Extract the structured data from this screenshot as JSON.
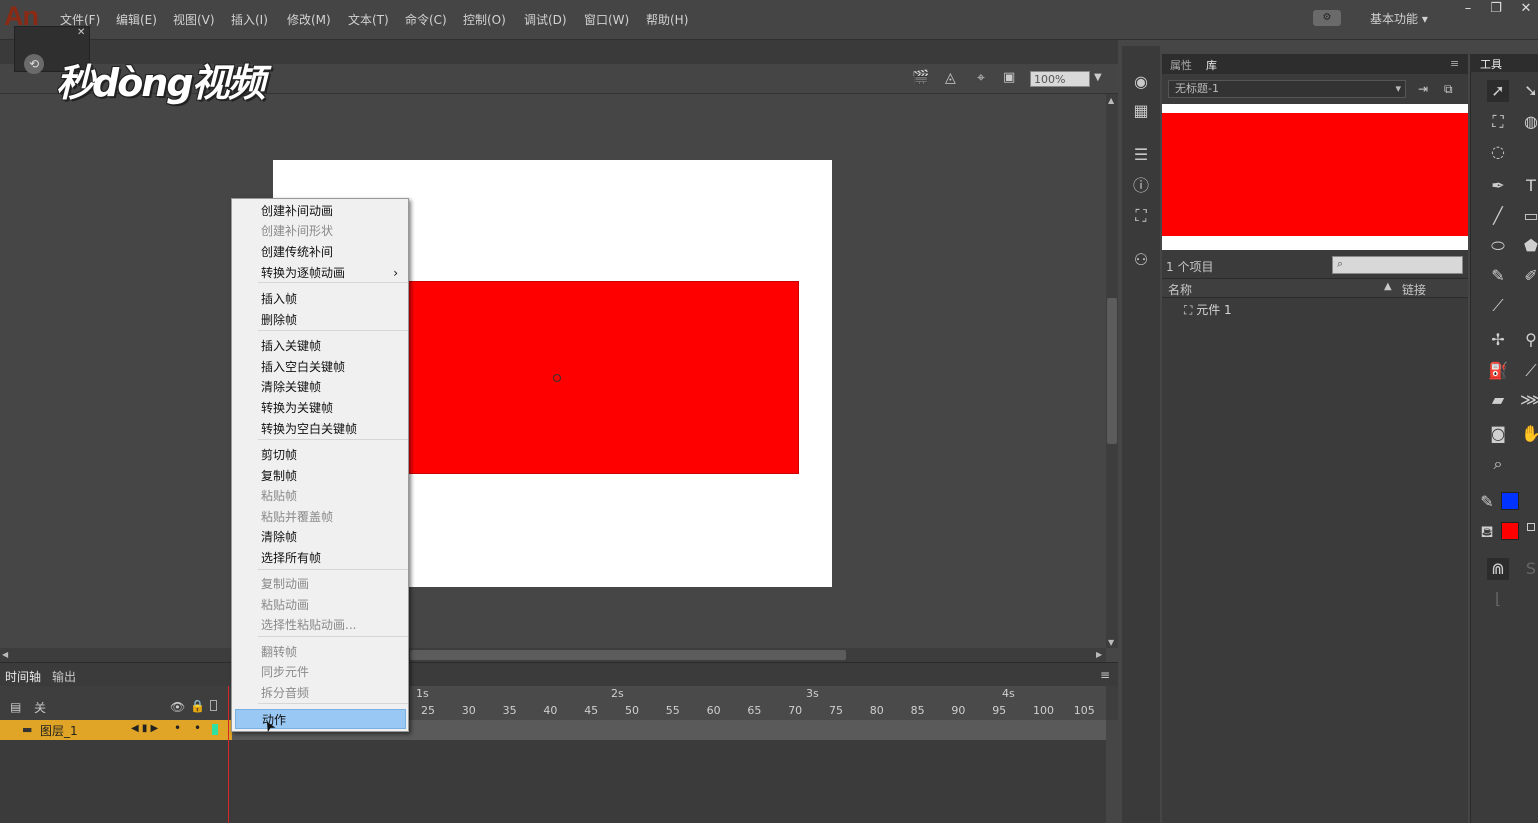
{
  "app": {
    "logo": "An"
  },
  "menubar": {
    "items": [
      "文件(F)",
      "编辑(E)",
      "视图(V)",
      "插入(I)",
      "修改(M)",
      "文本(T)",
      "命令(C)",
      "控制(O)",
      "调试(D)",
      "窗口(W)",
      "帮助(H)"
    ],
    "workspace": "基本功能"
  },
  "watermark": {
    "text": "秒dòng视频"
  },
  "editbar": {
    "zoom": "100%"
  },
  "timeline": {
    "tabs": [
      "时间轴",
      "输出"
    ],
    "layer_folder": "关",
    "layer_name": "图层_1",
    "seconds": [
      "1s",
      "2s",
      "3s",
      "4s"
    ],
    "frames": [
      "25",
      "30",
      "35",
      "40",
      "45",
      "50",
      "55",
      "60",
      "65",
      "70",
      "75",
      "80",
      "85",
      "90",
      "95",
      "100",
      "105"
    ]
  },
  "context_menu": {
    "items": [
      {
        "label": "创建补间动画",
        "enabled": true
      },
      {
        "label": "创建补间形状",
        "enabled": false
      },
      {
        "label": "创建传统补间",
        "enabled": true
      },
      {
        "label": "转换为逐帧动画",
        "enabled": true,
        "submenu": true
      },
      {
        "label": "插入帧",
        "enabled": true
      },
      {
        "label": "删除帧",
        "enabled": true
      },
      {
        "label": "插入关键帧",
        "enabled": true
      },
      {
        "label": "插入空白关键帧",
        "enabled": true
      },
      {
        "label": "清除关键帧",
        "enabled": true
      },
      {
        "label": "转换为关键帧",
        "enabled": true
      },
      {
        "label": "转换为空白关键帧",
        "enabled": true
      },
      {
        "label": "剪切帧",
        "enabled": true
      },
      {
        "label": "复制帧",
        "enabled": true
      },
      {
        "label": "粘贴帧",
        "enabled": false
      },
      {
        "label": "粘贴并覆盖帧",
        "enabled": false
      },
      {
        "label": "清除帧",
        "enabled": true
      },
      {
        "label": "选择所有帧",
        "enabled": true
      },
      {
        "label": "复制动画",
        "enabled": false
      },
      {
        "label": "粘贴动画",
        "enabled": false
      },
      {
        "label": "选择性粘贴动画...",
        "enabled": false
      },
      {
        "label": "翻转帧",
        "enabled": false
      },
      {
        "label": "同步元件",
        "enabled": false
      },
      {
        "label": "拆分音频",
        "enabled": false
      },
      {
        "label": "动作",
        "enabled": true,
        "highlighted": true
      }
    ]
  },
  "library": {
    "tabs": [
      "属性",
      "库"
    ],
    "document": "无标题-1",
    "count": "1 个项目",
    "col_name": "名称",
    "col_link": "链接",
    "item": "元件 1",
    "preview_color": "#ff0000"
  },
  "tools": {
    "title": "工具",
    "stroke_color": "#0033ff",
    "fill_color": "#ff0000"
  },
  "stage": {
    "shape_color": "#ff0000",
    "background": "#ffffff"
  }
}
